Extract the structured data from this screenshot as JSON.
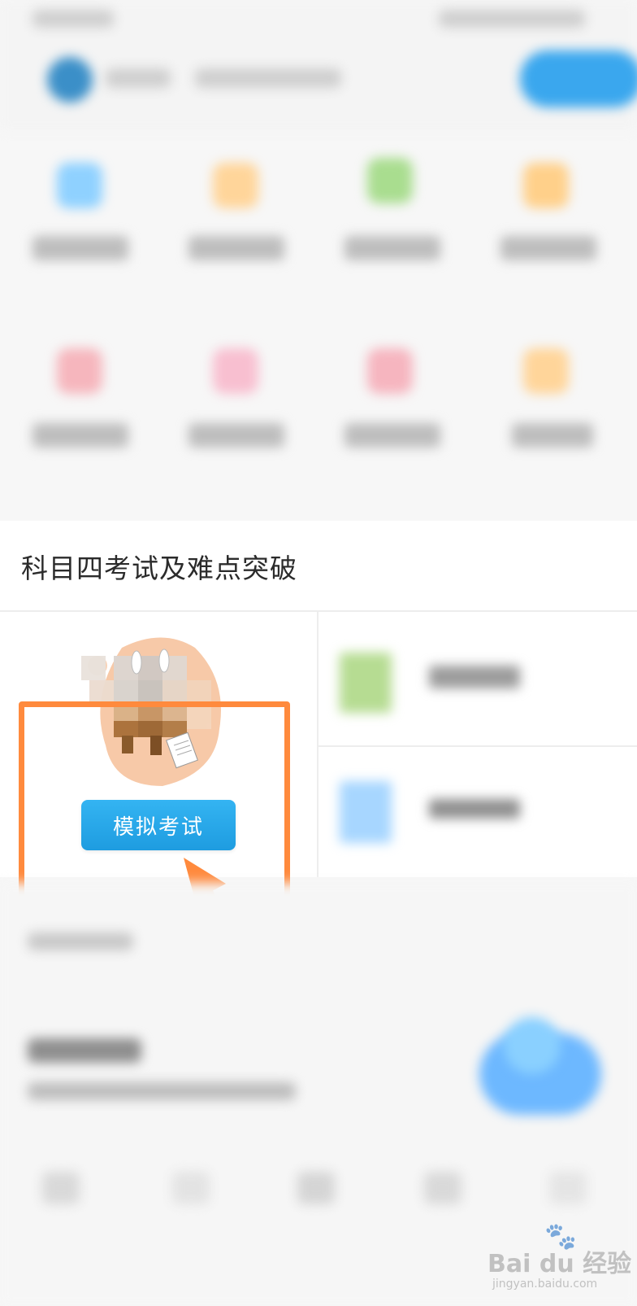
{
  "section": {
    "title": "科目四考试及难点突破"
  },
  "mock_exam": {
    "button_label": "模拟考试"
  },
  "annotation": {
    "highlight_color": "#ff8a3d"
  },
  "watermark": {
    "brand": "Bai du 经验",
    "url": "jingyan.baidu.com"
  },
  "colors": {
    "accent": "#1e9ce0",
    "annotation": "#ff8a3d"
  },
  "icons": {
    "mascot": "rabbit-desk-illustration",
    "paw": "baidu-paw-icon"
  }
}
